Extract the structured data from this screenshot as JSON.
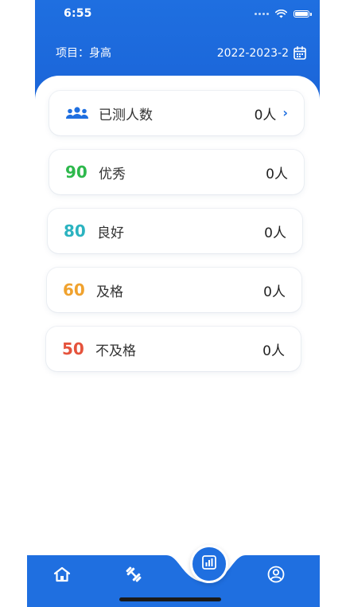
{
  "status_bar": {
    "time": "6:55"
  },
  "header": {
    "project_label": "项目：身高",
    "term": "2022-2023-2"
  },
  "summary": {
    "label": "已测人数",
    "count": "0人"
  },
  "grades": [
    {
      "score": "90",
      "label": "优秀",
      "count": "0人",
      "color": "#2db84c"
    },
    {
      "score": "80",
      "label": "良好",
      "count": "0人",
      "color": "#2bb3c0"
    },
    {
      "score": "60",
      "label": "及格",
      "count": "0人",
      "color": "#f0a22e"
    },
    {
      "score": "50",
      "label": "不及格",
      "count": "0人",
      "color": "#e5533c"
    }
  ],
  "colors": {
    "primary": "#1f6fe0",
    "text": "#333333"
  },
  "tabbar": {
    "tabs": [
      {
        "icon": "home-icon"
      },
      {
        "icon": "dumbbell-icon"
      },
      {
        "icon": "chart-icon"
      },
      {
        "icon": "user-icon"
      }
    ]
  }
}
